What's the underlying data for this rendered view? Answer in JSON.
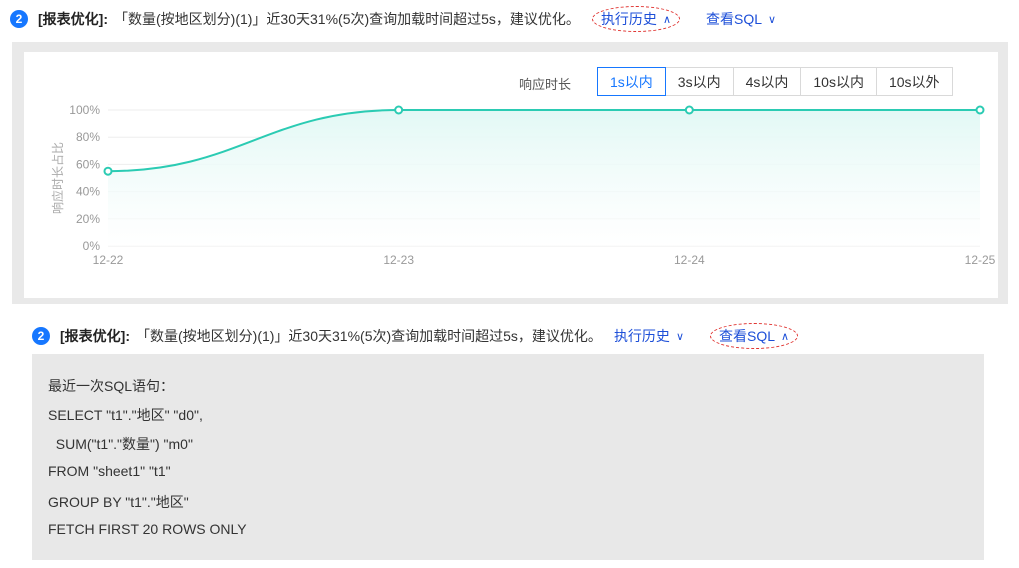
{
  "row1": {
    "badge": "2",
    "tag": "[报表优化]:",
    "message": "「数量(按地区划分)(1)」近30天31%(5次)查询加载时间超过5s，建议优化。",
    "history_link": "执行历史",
    "sql_link": "查看SQL"
  },
  "chart": {
    "range_label": "响应时长",
    "ranges": [
      "1s以内",
      "3s以内",
      "4s以内",
      "10s以内",
      "10s以外"
    ],
    "active_range": "1s以内"
  },
  "chart_data": {
    "type": "area",
    "x": [
      "12-22",
      "12-23",
      "12-24",
      "12-25"
    ],
    "series": [
      {
        "values": [
          55,
          100,
          100,
          100
        ]
      }
    ],
    "ylabel": "响应时长占比",
    "yticks": [
      "0%",
      "20%",
      "40%",
      "60%",
      "80%",
      "100%"
    ],
    "ylim": [
      0,
      100
    ],
    "grid": true,
    "colors": {
      "line": "#2bcbb3",
      "fill": "#e2f8f5"
    }
  },
  "row2": {
    "badge": "2",
    "tag": "[报表优化]:",
    "message": "「数量(按地区划分)(1)」近30天31%(5次)查询加载时间超过5s，建议优化。",
    "history_link": "执行历史",
    "sql_link": "查看SQL"
  },
  "sql": {
    "title": "最近一次SQL语句：",
    "lines": [
      "SELECT \"t1\".\"地区\" \"d0\",",
      "  SUM(\"t1\".\"数量\") \"m0\"",
      "FROM \"sheet1\" \"t1\"",
      "GROUP BY \"t1\".\"地区\"",
      "FETCH FIRST 20 ROWS ONLY"
    ]
  },
  "colors": {
    "accent": "#1677ff",
    "annotation": "#e0322f",
    "link": "#1d4fd8"
  }
}
